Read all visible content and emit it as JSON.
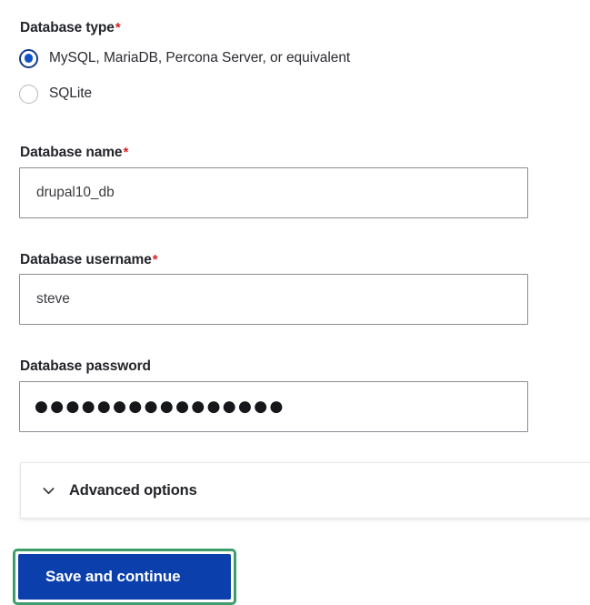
{
  "form": {
    "database_type": {
      "label": "Database type",
      "required": true,
      "required_marker": "*",
      "selected": "mysql",
      "options": [
        {
          "id": "mysql",
          "label": "MySQL, MariaDB, Percona Server, or equivalent",
          "checked": true
        },
        {
          "id": "sqlite",
          "label": "SQLite",
          "checked": false
        }
      ]
    },
    "database_name": {
      "label": "Database name",
      "required": true,
      "required_marker": "*",
      "value": "drupal10_db",
      "placeholder": ""
    },
    "database_username": {
      "label": "Database username",
      "required": true,
      "required_marker": "*",
      "value": "steve",
      "placeholder": ""
    },
    "database_password": {
      "label": "Database password",
      "required": false,
      "value_masked": "●●●●●●●●●●●●●●●●",
      "masked_char_count": 16,
      "placeholder": ""
    },
    "advanced_options": {
      "title": "Advanced options",
      "expanded": false,
      "icon": "chevron-down-icon"
    },
    "submit": {
      "label": "Save and continue",
      "focused": true
    }
  },
  "colors": {
    "accent_blue": "#0b3fac",
    "radio_ring": "#12398f",
    "radio_dot": "#1053c4",
    "focus_ring_green": "#3d9e6b",
    "required_red": "#d72222",
    "input_border": "#8a8d92",
    "text": "#232429",
    "panel_border": "#e7e7e9"
  }
}
